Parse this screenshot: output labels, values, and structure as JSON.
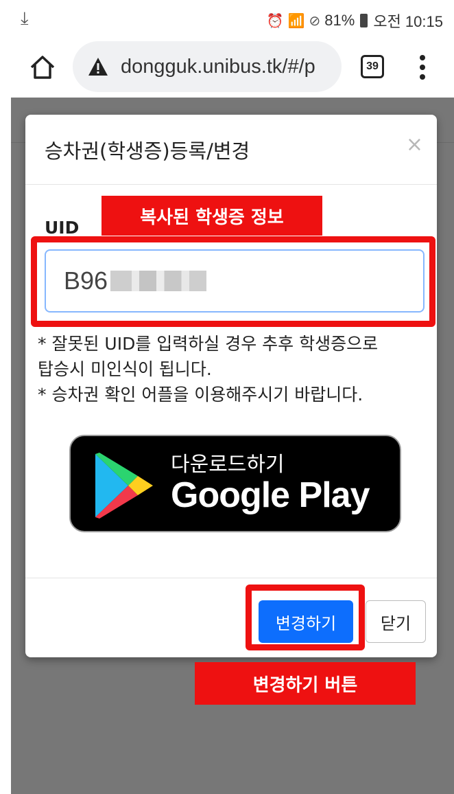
{
  "status_bar": {
    "battery": "81%",
    "time": "오전 10:15"
  },
  "browser": {
    "url": "dongguk.unibus.tk/#/p",
    "tab_count": "39"
  },
  "modal": {
    "title": "승차권(학생증)등록/변경",
    "close_symbol": "×",
    "uid_label": "UID",
    "uid_value": "B96",
    "notice_line1": "* 잘못된 UID를 입력하실 경우 추후 학생증으로",
    "notice_line2": "탑승시 미인식이 됩니다.",
    "notice_line3": "* 승차권 확인 어플을 이용해주시기 바랍니다.",
    "google_play": {
      "small_text": "다운로드하기",
      "big_text": "Google Play"
    },
    "change_button": "변경하기",
    "close_button": "닫기"
  },
  "annotations": {
    "copied_info": "복사된 학생증 정보",
    "change_button_label": "변경하기 버튼",
    "color": "#ee1111"
  },
  "colors": {
    "primary": "#0d6efd",
    "overlay": "#777777"
  }
}
